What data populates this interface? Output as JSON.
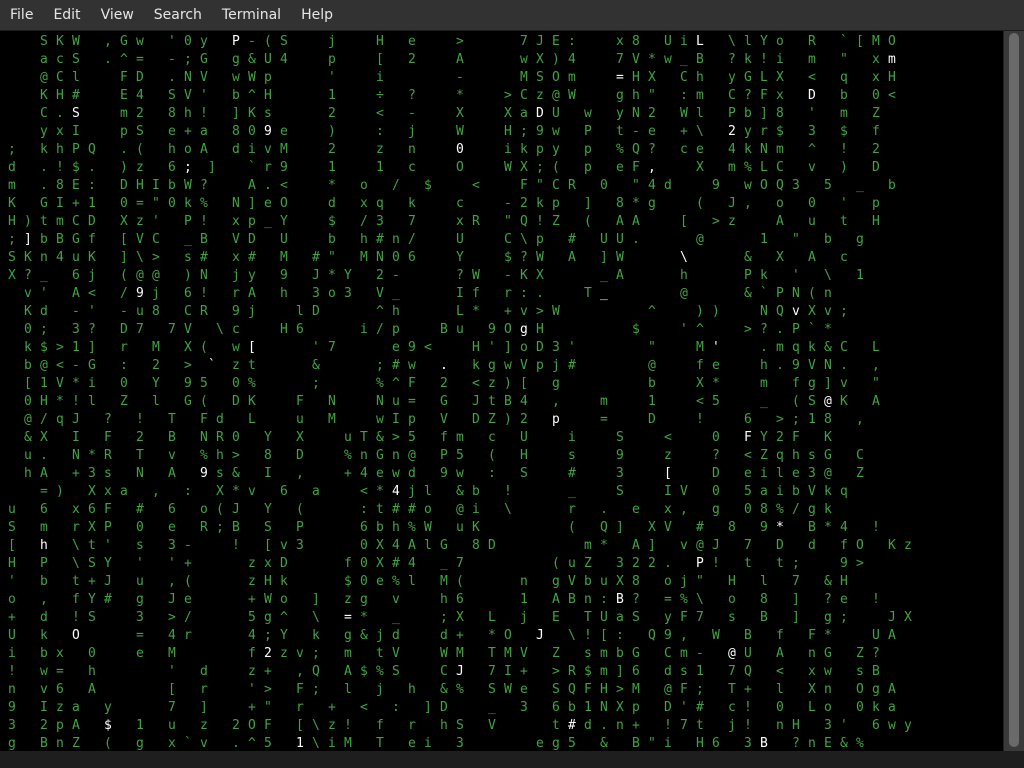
{
  "menu": {
    "items": [
      "File",
      "Edit",
      "View",
      "Search",
      "Terminal",
      "Help"
    ]
  },
  "terminal": {
    "colors": {
      "background": "#000000",
      "green": "#3fa53f",
      "white": "#ffffff"
    },
    "rows": [
      "     S K W   , G w   ' 0 y   P - ( S     j     H   e     >       7 J E :     x 8   U i L   \\ l Y o   R   ` [ M O ",
      "     a c S   . ^ =   - ; G   g & U 4     p     [   2     A       w X ) 4     7 V * w _ B   ? k ! i   m   \"   x m ",
      "     @ C l     F D   . N V   w W p       '     i         -       M S O m     = H X   C h   y G L X   <   q   x H ",
      "     K H #     E 4   S V '   b ^ H       1     ÷   ?     *     > C z @ W     g h \"   : m   C ? F x   D   b   0 < ",
      "     C . S     m 2   8 h !   ] K s       2     <   -     X     X a D U   w   y N 2   W l   P b ] 8   '   m   Z   ",
      "     y x I     p S   e + a   8 0 9 e     )     :   j     W     H ; 9 w   P   t - e   + \\   2 y r $   3   $   f   ",
      " ;   k h P Q   . (   h o A   d i v M     2     z   n     0     i k p y   p   % Q ?   c e   4 k N m   ^   !   2   ",
      " d   . ! $ .   ) z   6 ;  ]    ` r 9     1     1   c     O     W X ; (   p   e F ,     X   m % L C   v   )   D   ",
      " m   . 8 E :   D H I b W ?     A . <     *   o   /   $     <     F \" C R   0   \" 4 d     9   w O Q 3   5   _   b   ",
      " K   G I + 1   0 = \" 0 k %   N ] e O     d   x q   k     c     - 2 k p   ]   8 * g     (   J ,   o   0   '   p   ",
      " H ) t m C D   X z '   P !   x p _ Y     $   / 3   7     x R   \" Q ! Z   (   A A     [   > z     A   u   t   H ",
      " ; ] b B G f   [ V C   _ B   V D   U     b   h # n /     U     C \\ p   #   U U .       @       1   \"   b   g ",
      " S K n 4 u K   ] \\ >   s #   x #   M   # \"   M N 0 6     Y     $ ? W   A   ] W       \\       &   X   A   c ",
      " X ? _   6 j   ( @ @   ) N   j y   9   J * Y   2 -       ? W   - K X       _ A       h       P k   '   \\   1 ",
      "   v '   A <   / 9 j   6 !   r A   h   3 o 3   V _       I f   r : .     T _         @       & ` P N ( n     ",
      "   K d   - '   - u 8   C R   9 j     l D       ^ h       L *   + v > W           ^     ) )     N Q v X v ;     ",
      "   0 ;   3 ?   D 7   7 V   \\ c     H 6       i / p     B u   9 O g H           $     ' ^     > ? . P ` *     ",
      "   k $ > 1 ]   r   M   X (   w [       ' 7       e 9 <     H ' ] o D 3 '         \"     M '     . m q k & C   L ",
      "   b @ < - G   :   2   >  `  z t       &       ; # w   .   k g w V p j #         @     f e     h . 9 V N .   , ",
      "   [ 1 V * i   0   Y   9 5   0 %       ;       % ^ F   2   < z ) [   g           b     X *     m   f g ] v   \" ",
      "   0 H * ! l   Z   l   G (   D K     F   N     N u =   G   J t B 4   ,     m     1     < 5     _   ( S @ K   A ",
      "   @ / q J   ?   !   T   F d   L     u   M     w I p   V   D Z ) 2   p     =     D     !     6   > ; 1 8   , ",
      "   & X   I   F   2   B   N R 0   Y   X     u T & > 5   f m   c   U     i     S     <     0   F Y 2 F   K   ",
      "   u .   N * R   T   v   % h >   8   D     % n G n @   P 5   (   H     s     9     z     ?   < Z q h s G   C ",
      "   h A   + 3 s   N   A   9 s &   I   ,     + 4 e w d   9 w   :   S     #     3     [     D   e i l e 3 @   Z ",
      "     = )   X x a   ,   :   X * v   6   a     < * 4 j l   & b   !       _     S     I V   0   5 a i b V k q   ",
      " u   6   x 6 F   #   6   o ( J   Y   (       : t # # o   @ i   \\       r   .   e   x ,   g   0 8 % / g k     ",
      " S   m   r X P   0   e   R ; B   S   P       6 b h % W   u K           (   Q ]   X V   #   8   9 *   B * 4   ! ",
      " [   h   \\ t '   s   3 -     !   [ v 3       0 X 4 A l G   8 D           m *   A ]   v @ J   7   D   d   f O   K z ",
      " H   P   \\ S Y   '   ' +       z x D       f 0 X # 4   _ 7           ( u Z   3 2 2 .   P !   t   t ;     9 > ",
      " '   b   t + J   u   , (       z H k       $ 0 e % l   M (       n   g V b u X 8   o j \"   H   l   7   & H ",
      " o   ,   f Y #   g   J e       + W o   ]   z g   v     h 6       1   A B n : B ?   = % \\   o   8   ]   ? e   ! ",
      " +   d   ! S     3   > /       5 g ^   \\   = *   _     ; X   L   j   E   T U a S   y F 7   s   B   ]   g ;     J X ",
      " U   k   O       =   4 r       4 ; Y   k   g & j d     d +   * O   J   \\ ! [ :   Q 9 ,   W   B   f   F *     U A ",
      " i   b x   0     e   M         f 2 z v ;   m   t V     W M   T M V   Z   s m b G   C m -   @ U   A   n G   Z ? ",
      " !   w =   h         '   d     z +   , Q   A $ % S     C J   7 I +   > R $ m ] 6   d s 1   7 Q   <   x w   s B ",
      " n   v 6   A         [   r     ' >   F ;   l   j   h   & %   S W e   S Q F H > M   @ F ;   T +   l   X n   O g A ",
      " 9   I z a   y       7   ]     + \"   r   +   <   :   ] D     _   3   6 b 1 N X p   D ' #   c !   0   L o   0 k a ",
      " 3   2 p A   $   1   u   z   2 O F   [ \\ z !   f   r   h S   V       t # d . n +   ! 7 t   j !   n H   3 '   6 w y ",
      " g   B n Z   (   g   x ` v   . ^ 5   1 \\ i M   T   e i   3         e g 5   &   B \" i   H 6   3 B   ? n E & %   "
    ]
  }
}
